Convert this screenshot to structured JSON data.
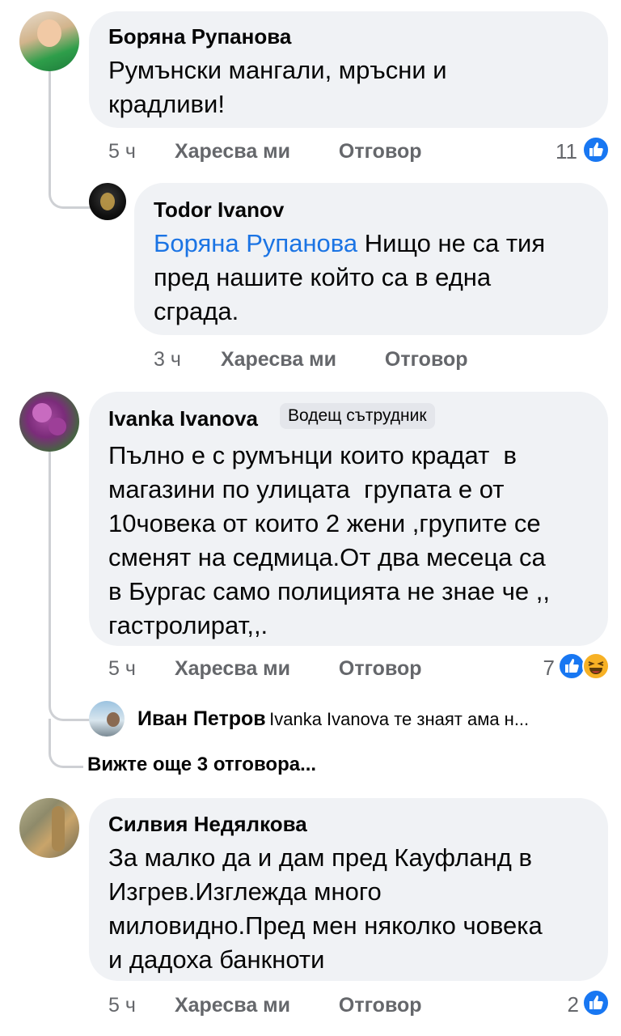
{
  "comments": [
    {
      "author": "Боряна Рупанова",
      "lines": [
        "Румънски мангали, мръсни и",
        "крадливи!"
      ],
      "time": "5 ч",
      "like_label": "Харесва ми",
      "reply_label": "Отговор",
      "reactions": "11"
    },
    {
      "author": "Todor Ivanov",
      "mention": "Боряна Рупанова",
      "line1_rest": " Нищо не са тия",
      "lines": [
        "пред нашите който са в една",
        "сграда."
      ],
      "time": "3 ч",
      "like_label": "Харесва ми",
      "reply_label": "Отговор"
    },
    {
      "author": "Ivanka Ivanova",
      "badge": "Водещ сътрудник",
      "lines": [
        "Пълно е с румънци които крадат  в",
        "магазини по улицата  групата е от",
        "10човека от които 2 жени ,групите се",
        "сменят на седмица.От два месеца са",
        "в Бургас само полицията не знае че ,,",
        "гастролират,,."
      ],
      "time": "5 ч",
      "like_label": "Харесва ми",
      "reply_label": "Отговор",
      "reactions": "7"
    },
    {
      "author": "Силвия Недялкова",
      "lines": [
        "За малко да и дам пред Кауфланд в",
        "Изгрев.Изглежда много",
        "миловидно.Пред мен няколко човека",
        "и дадоха банкноти"
      ],
      "time": "5 ч",
      "like_label": "Харесва ми",
      "reply_label": "Отговор",
      "reactions": "2"
    }
  ],
  "reply_preview": {
    "author": "Иван Петров",
    "text": "Ivanka Ivanova те знаят ама н..."
  },
  "more_replies": "Вижте още 3 отговора...",
  "colors": {
    "bubble": "#f0f2f5",
    "secondary": "#65676b",
    "link": "#1b74e4",
    "like": "#1877f2",
    "haha": "#f7b125"
  },
  "icons": [
    "like-reaction-icon",
    "haha-reaction-icon"
  ]
}
